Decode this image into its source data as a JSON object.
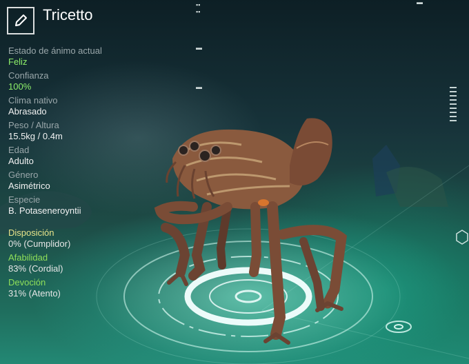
{
  "creature": {
    "name": "Tricetto"
  },
  "icons": {
    "edit": "pencil-icon"
  },
  "stats": [
    {
      "label": "Estado de ánimo actual",
      "value": "Feliz",
      "highlight": true
    },
    {
      "label": "Confianza",
      "value": "100%",
      "highlight": true
    },
    {
      "label": "Clima nativo",
      "value": "Abrasado",
      "highlight": false
    },
    {
      "label": "Peso / Altura",
      "value": "15.5kg / 0.4m",
      "highlight": false
    },
    {
      "label": "Edad",
      "value": "Adulto",
      "highlight": false
    },
    {
      "label": "Género",
      "value": "Asimétrico",
      "highlight": false
    },
    {
      "label": "Especie",
      "value": "B. Potaseneroyntii",
      "highlight": false
    }
  ],
  "traits": [
    {
      "label": "Disposición",
      "value": "0% (Cumplidor)",
      "color": "#e8e48a"
    },
    {
      "label": "Afabilidad",
      "value": "83% (Cordial)",
      "color": "#8fe05a"
    },
    {
      "label": "Devoción",
      "value": "31% (Atento)",
      "color": "#8fe05a"
    }
  ]
}
